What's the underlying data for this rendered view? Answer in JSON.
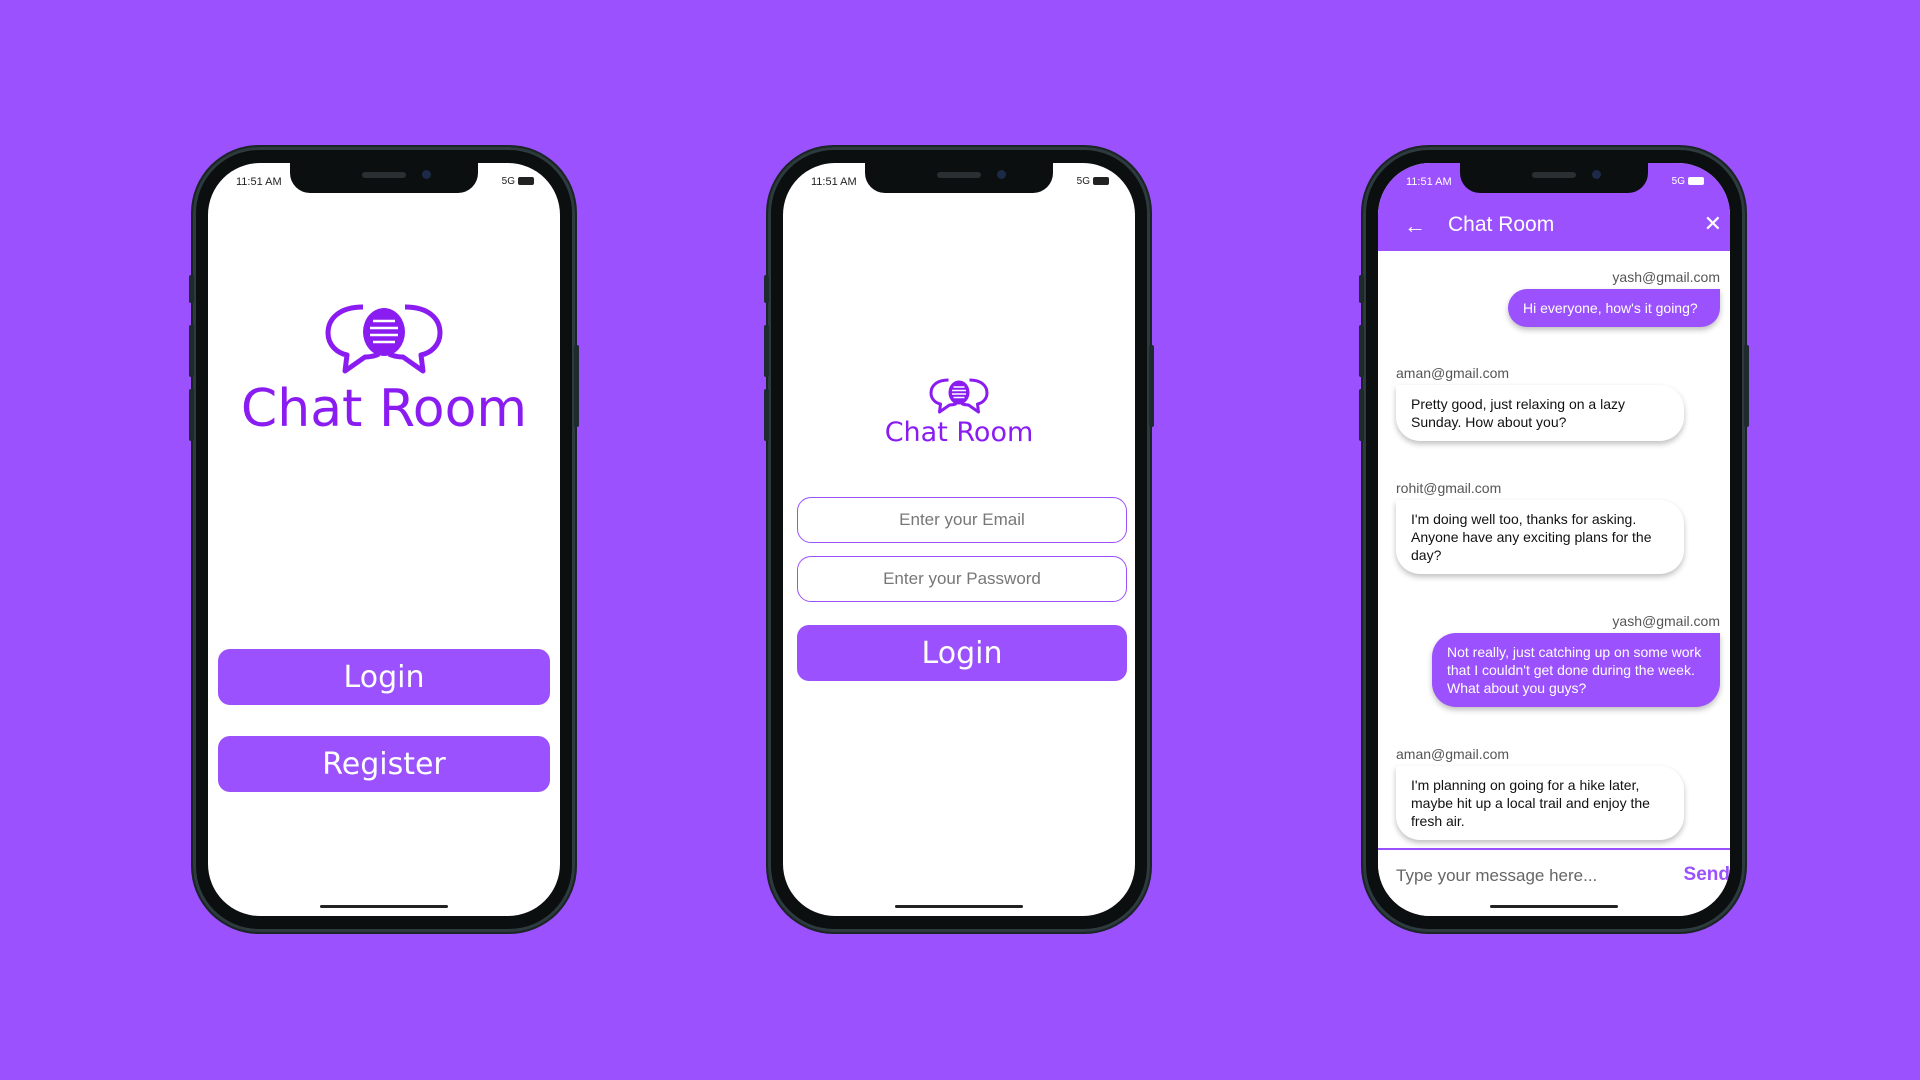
{
  "theme": {
    "accent": "#9B51FD",
    "brand_text": "#8A1CF2",
    "background": "#9B51FD"
  },
  "phone1": {
    "status_time": "11:51 AM",
    "status_right": "5G",
    "logo_icon": "chat-bubbles-icon",
    "brand": "Chat Room",
    "login_label": "Login",
    "register_label": "Register"
  },
  "phone2": {
    "status_time": "11:51 AM",
    "status_right": "5G",
    "logo_icon": "chat-bubbles-icon",
    "brand": "Chat Room",
    "email_placeholder": "Enter your Email",
    "password_placeholder": "Enter your Password",
    "login_label": "Login"
  },
  "phone3": {
    "status_time": "11:51 AM",
    "status_right": "5G",
    "back_icon": "arrow-left-icon",
    "title": "Chat Room",
    "close_icon": "close-icon",
    "messages": [
      {
        "sender": "yash@gmail.com",
        "text": "Hi everyone, how's it going?",
        "me": true
      },
      {
        "sender": "aman@gmail.com",
        "text": "Pretty good, just relaxing on a lazy Sunday. How about you?",
        "me": false
      },
      {
        "sender": "rohit@gmail.com",
        "text": "I'm doing well too, thanks for asking. Anyone have any exciting plans for the day?",
        "me": false
      },
      {
        "sender": "yash@gmail.com",
        "text": "Not really, just catching up on some work that I couldn't get done during the week. What about you guys?",
        "me": true
      },
      {
        "sender": "aman@gmail.com",
        "text": "I'm planning on going for a hike later, maybe hit up a local trail and enjoy the fresh air.",
        "me": false
      }
    ],
    "message_placeholder": "Type your message here...",
    "send_label": "Send"
  }
}
